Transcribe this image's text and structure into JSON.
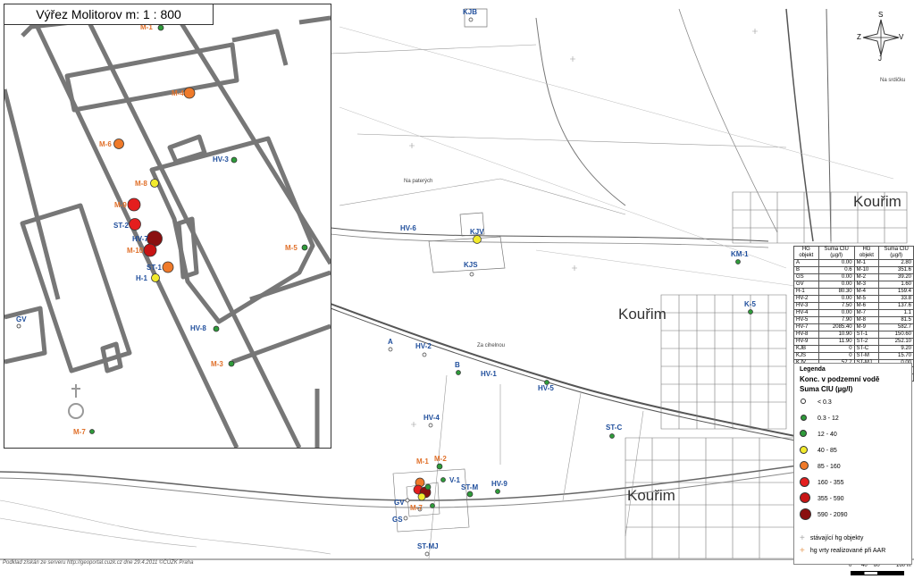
{
  "inset": {
    "title": "Výřez Molitorov m: 1 : 800",
    "labels": [
      "M-1",
      "M-4",
      "M-6",
      "HV-3",
      "M-8",
      "M-9",
      "ST-2",
      "HV-7",
      "M-10",
      "ST-1",
      "H-1",
      "M-5",
      "HV-8",
      "M-3",
      "GV",
      "M-7"
    ]
  },
  "map": {
    "towns": [
      "Kouřim",
      "Kouřim",
      "Kouřim"
    ],
    "place_names": [
      "Na paterých",
      "Za cihelnou",
      "Na srdičku"
    ],
    "labels": [
      "KJB",
      "HV-6",
      "KJV",
      "KJS",
      "KM-1",
      "K-5",
      "A",
      "HV-2",
      "B",
      "HV-1",
      "HV-5",
      "HV-4",
      "ST-C",
      "M-1",
      "M-2",
      "V-1",
      "ST-M",
      "HV-9",
      "GV",
      "GS",
      "M-7",
      "ST-MJ"
    ]
  },
  "compass": {
    "n": "S",
    "s": "J",
    "e": "V",
    "w": "Z"
  },
  "table": {
    "headers": [
      "HG objekt",
      "Suma ClU (µg/l)",
      "HG objekt",
      "Suma ClU (µg/l)"
    ],
    "rows": [
      [
        "A",
        "0.00",
        "M-1",
        "2.80"
      ],
      [
        "B",
        "0.6",
        "M-10",
        "351.6"
      ],
      [
        "GS",
        "0.00",
        "M-2",
        "39.20"
      ],
      [
        "GV",
        "0.00",
        "M-3",
        "1.60"
      ],
      [
        "H-1",
        "80.30",
        "M-4",
        "159.4"
      ],
      [
        "HV-2",
        "0.00",
        "M-5",
        "33.8"
      ],
      [
        "HV-3",
        "7.50",
        "M-6",
        "137.6"
      ],
      [
        "HV-4",
        "0.00",
        "M-7",
        "1.1"
      ],
      [
        "HV-5",
        "7.90",
        "M-8",
        "81.5"
      ],
      [
        "HV-7",
        "2085.40",
        "M-9",
        "582.7"
      ],
      [
        "HV-8",
        "10.90",
        "ST-1",
        "150.60"
      ],
      [
        "HV-9",
        "11.90",
        "ST-2",
        "252.10"
      ],
      [
        "KJB",
        "0",
        "ST-C",
        "9.20"
      ],
      [
        "KJS",
        "0",
        "ST-M",
        "15.70"
      ],
      [
        "KJV",
        "57.7",
        "ST-MJ",
        "0.00"
      ],
      [
        "KM-1",
        "1.3",
        "V-1",
        "22.70"
      ],
      [
        "K-5",
        "6",
        "",
        ""
      ]
    ]
  },
  "legend": {
    "title": "Legenda",
    "subtitle": "Konc. v podzemní vodě",
    "unit": "Suma ClU  (µg/l)",
    "classes": [
      {
        "label": "< 0.3",
        "color": "#ffffff"
      },
      {
        "label": "0.3 - 12",
        "color": "#2e9b3a"
      },
      {
        "label": "12 - 40",
        "color": "#2e9b3a"
      },
      {
        "label": "40 - 85",
        "color": "#f2ea2c"
      },
      {
        "label": "85 - 160",
        "color": "#ef7a2a"
      },
      {
        "label": "160 - 355",
        "color": "#e41e1e"
      },
      {
        "label": "355 - 590",
        "color": "#c81414"
      },
      {
        "label": "590 - 2090",
        "color": "#8a1010"
      }
    ],
    "extra1": "stávající hg objekty",
    "extra2": "hg vrty realizované při AAR"
  },
  "footer": "Podklad získán ze serveru  http://geoportal.cuzk.cz dne 29.4.2011 ©ČÚZK Praha",
  "scale": {
    "ticks": [
      "0",
      "40",
      "80",
      "160 m"
    ]
  },
  "colors": {
    "green": "#2e9b3a",
    "yellow": "#f2ea2c",
    "orange": "#ef7a2a",
    "red": "#e41e1e",
    "darkred": "#8a1010",
    "label_blue": "#1f4e9c",
    "label_orange": "#e0702a"
  }
}
